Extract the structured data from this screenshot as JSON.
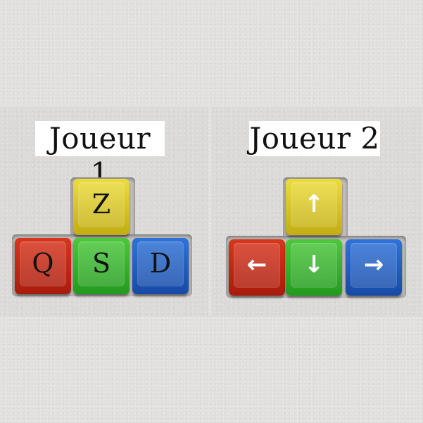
{
  "players": [
    {
      "title": "Joueur 1",
      "keys": {
        "up": {
          "label": "Z",
          "color": "#e2d02a",
          "icon": ""
        },
        "left": {
          "label": "Q",
          "color": "#c9281a",
          "icon": ""
        },
        "down": {
          "label": "S",
          "color": "#37b22f",
          "icon": ""
        },
        "right": {
          "label": "D",
          "color": "#215fc2",
          "icon": ""
        }
      }
    },
    {
      "title": "Joueur 2",
      "keys": {
        "up": {
          "label": "↑",
          "color": "#e2d02a",
          "icon": "arrow-up-icon"
        },
        "left": {
          "label": "←",
          "color": "#c9281a",
          "icon": "arrow-left-icon"
        },
        "down": {
          "label": "↓",
          "color": "#37b22f",
          "icon": "arrow-down-icon"
        },
        "right": {
          "label": "→",
          "color": "#215fc2",
          "icon": "arrow-right-icon"
        }
      }
    }
  ]
}
